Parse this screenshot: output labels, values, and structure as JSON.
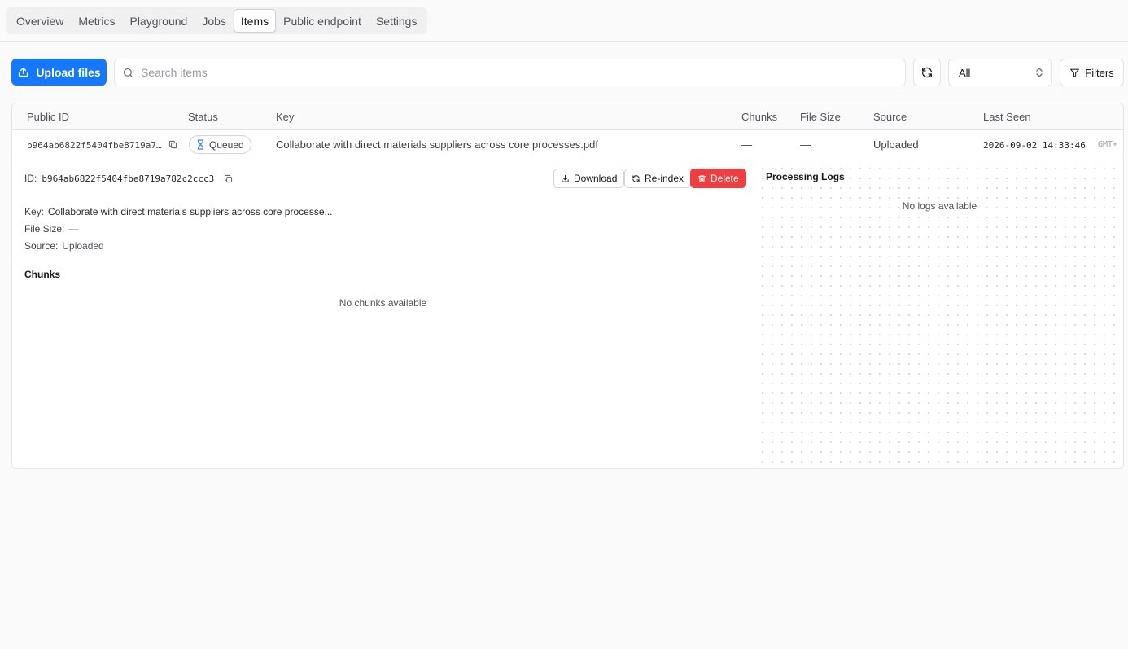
{
  "tabs": [
    {
      "label": "Overview"
    },
    {
      "label": "Metrics"
    },
    {
      "label": "Playground"
    },
    {
      "label": "Jobs"
    },
    {
      "label": "Items",
      "active": true
    },
    {
      "label": "Public endpoint"
    },
    {
      "label": "Settings"
    }
  ],
  "toolbar": {
    "upload_label": "Upload files",
    "search_placeholder": "Search items",
    "search_value": "",
    "filter_select_value": "All",
    "filters_label": "Filters"
  },
  "table": {
    "columns": [
      "Public ID",
      "Status",
      "Key",
      "Chunks",
      "File Size",
      "Source",
      "Last Seen"
    ],
    "rows": [
      {
        "public_id": "b964ab6822f5404fbe8719a7…",
        "status": "Queued",
        "key": "Collaborate with direct materials suppliers across core processes.pdf",
        "chunks": "—",
        "file_size": "—",
        "source": "Uploaded",
        "last_seen": "2026-09-02 14:33:46",
        "last_seen_tz": "GMT+"
      }
    ]
  },
  "detail": {
    "id_label": "ID:",
    "id_value": "b964ab6822f5404fbe8719a782c2ccc3",
    "download_label": "Download",
    "reindex_label": "Re-index",
    "delete_label": "Delete",
    "key_label": "Key:",
    "key_value": "Collaborate with direct materials suppliers across core processe...",
    "file_size_label": "File Size:",
    "file_size_value": "—",
    "source_label": "Source:",
    "source_value": "Uploaded",
    "chunks_title": "Chunks",
    "chunks_empty": "No chunks available",
    "logs_title": "Processing Logs",
    "logs_empty": "No logs available"
  },
  "colors": {
    "primary": "#1677ff",
    "danger": "#ef3e42",
    "border": "#e4e4e7",
    "status_icon": "#3b82f6"
  },
  "icons": {
    "upload": "upload-icon",
    "search": "search-icon",
    "refresh": "refresh-icon",
    "select": "chevron-up-down-icon",
    "filters": "filter-icon",
    "copy": "copy-icon",
    "status": "hourglass-icon",
    "download": "download-icon",
    "reindex": "refresh-icon",
    "delete": "trash-icon"
  }
}
